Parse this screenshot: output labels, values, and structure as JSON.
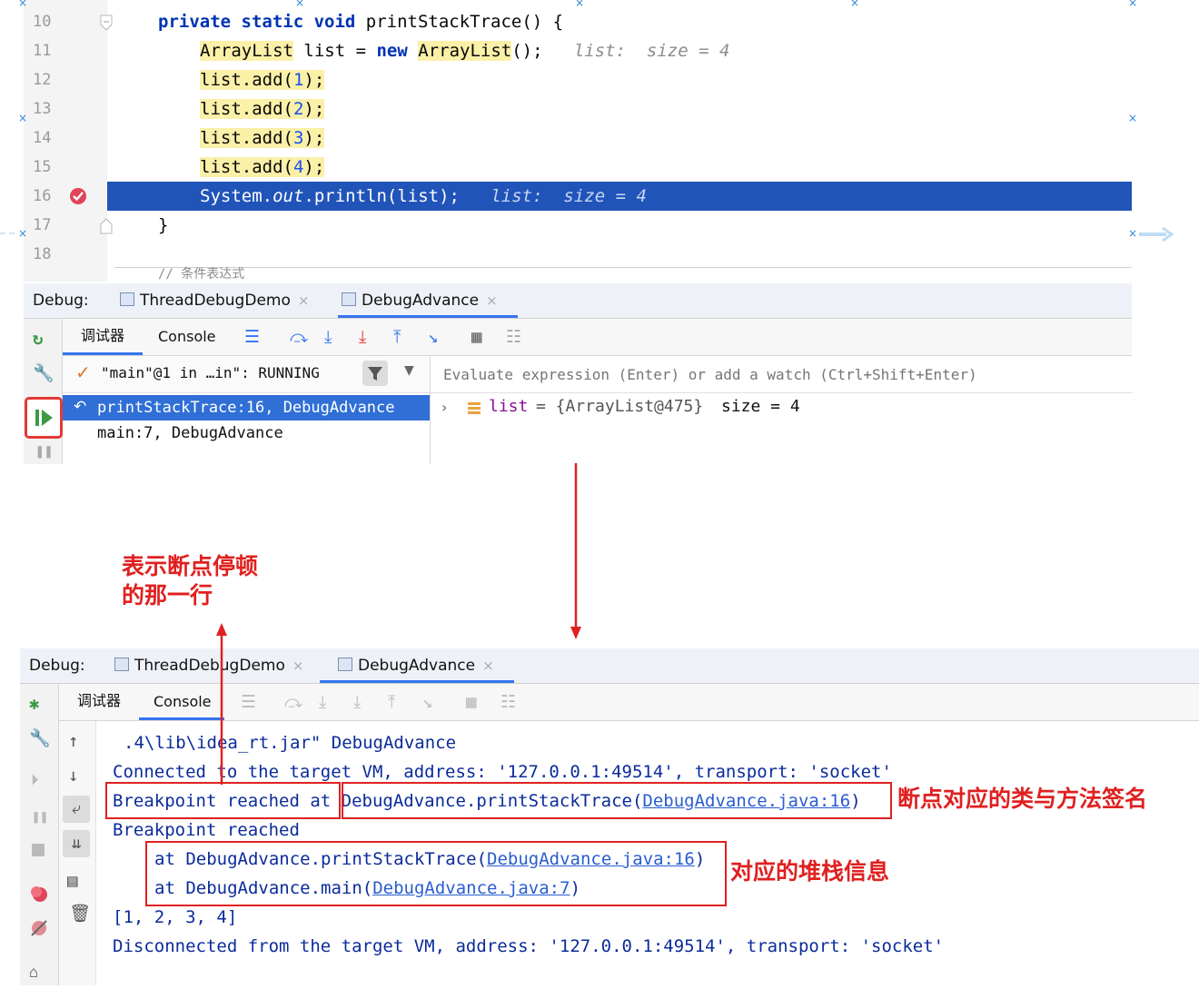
{
  "editor": {
    "lines": [
      {
        "n": "10"
      },
      {
        "n": "11"
      },
      {
        "n": "12"
      },
      {
        "n": "13"
      },
      {
        "n": "14"
      },
      {
        "n": "15"
      },
      {
        "n": "16"
      },
      {
        "n": "17"
      },
      {
        "n": "18"
      }
    ],
    "code": {
      "l10_kw": "private static void",
      "l10_rest": " printStackTrace() {",
      "l11_type": "ArrayList",
      "l11_mid": " list = ",
      "l11_new": "new",
      "l11_type2": "ArrayList",
      "l11_end": "();",
      "l11_inline": "list:  size = 4",
      "add_prefix": "list.add(",
      "add_end": ");",
      "n1": "1",
      "n2": "2",
      "n3": "3",
      "n4": "4",
      "l16_a": "System.",
      "l16_out": "out",
      "l16_b": ".println(list);",
      "l16_inline": "list:  size = 4",
      "l17": "}",
      "l19_partial": "// 条件表达式"
    }
  },
  "debug_top": {
    "label": "Debug:",
    "tabs": [
      "ThreadDebugDemo",
      "DebugAdvance"
    ],
    "subtabs": [
      "调试器",
      "Console"
    ],
    "thread": "\"main\"@1 in …in\": RUNNING",
    "eval_placeholder": "Evaluate expression (Enter) or add a watch (Ctrl+Shift+Enter)",
    "frames": [
      "printStackTrace:16, DebugAdvance",
      "main:7, DebugAdvance"
    ],
    "variable": {
      "name": "list",
      "value": "= {ArrayList@475}",
      "size": "size = 4"
    }
  },
  "debug_bottom": {
    "label": "Debug:",
    "tabs": [
      "ThreadDebugDemo",
      "DebugAdvance"
    ],
    "subtabs": [
      "调试器",
      "Console"
    ],
    "console": {
      "l0": ".4\\lib\\idea_rt.jar\" DebugAdvance",
      "l1": "Connected to the target VM, address: '127.0.0.1:49514', transport: 'socket'",
      "l2a": "Breakpoint reached at",
      "l2b": "DebugAdvance.printStackTrace(",
      "l2link": "DebugAdvance.java:16",
      "l2c": ")",
      "l3": "Breakpoint reached",
      "l4a": "at DebugAdvance.printStackTrace(",
      "l4link": "DebugAdvance.java:16",
      "l4c": ")",
      "l5a": "at DebugAdvance.main(",
      "l5link": "DebugAdvance.java:7",
      "l5c": ")",
      "l6": "[1, 2, 3, 4]",
      "l7": "Disconnected from the target VM, address: '127.0.0.1:49514', transport: 'socket'"
    }
  },
  "annotations": {
    "a1_line1": "表示断点停顿",
    "a1_line2": "的那一行",
    "a2": "断点对应的类与方法签名",
    "a3": "对应的堆栈信息"
  },
  "colors": {
    "accent": "#2154b9",
    "annotation": "#e02020",
    "keyword": "#0033b3"
  }
}
